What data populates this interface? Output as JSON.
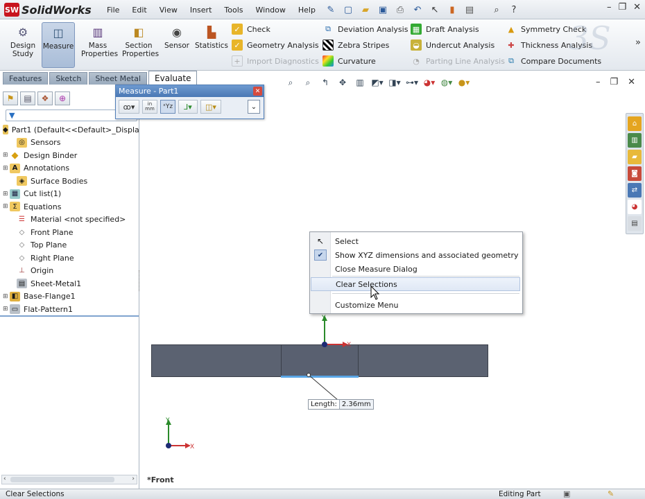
{
  "app": {
    "logo_text": "SolidWorks",
    "logo_mark": "SW"
  },
  "menu": [
    "File",
    "Edit",
    "View",
    "Insert",
    "Tools",
    "Window",
    "Help"
  ],
  "ribbon": {
    "big_buttons": [
      {
        "label": "Design Study"
      },
      {
        "label": "Measure"
      },
      {
        "label": "Mass Properties"
      },
      {
        "label": "Section Properties"
      },
      {
        "label": "Sensor"
      },
      {
        "label": "Statistics"
      }
    ],
    "col1": [
      "Check",
      "Geometry Analysis",
      "Import Diagnostics"
    ],
    "col2": [
      "Deviation Analysis",
      "Zebra Stripes",
      "Curvature"
    ],
    "col3": [
      "Draft Analysis",
      "Undercut Analysis",
      "Parting Line Analysis"
    ],
    "col4": [
      "Symmetry Check",
      "Thickness Analysis",
      "Compare Documents"
    ]
  },
  "tabs": [
    "Features",
    "Sketch",
    "Sheet Metal",
    "Evaluate"
  ],
  "measure_dialog": {
    "title": "Measure - Part1",
    "units_label": "in mm"
  },
  "tree": {
    "root": "Part1  (Default<<Default>_Displa",
    "items": [
      "Sensors",
      "Design Binder",
      "Annotations",
      "Surface Bodies",
      "Cut list(1)",
      "Equations",
      "Material <not specified>",
      "Front Plane",
      "Top Plane",
      "Right Plane",
      "Origin",
      "Sheet-Metal1",
      "Base-Flange1",
      "Flat-Pattern1"
    ]
  },
  "context_menu": {
    "items": [
      "Select",
      "Show XYZ dimensions and associated geometry",
      "Close Measure Dialog",
      "Clear Selections",
      "Customize Menu"
    ]
  },
  "measurement": {
    "label": "Length:",
    "value": "2.36mm"
  },
  "axes": {
    "x": "X",
    "y": "Y"
  },
  "view_label": "*Front",
  "status": {
    "left": "Clear Selections",
    "right": "Editing Part"
  },
  "watermark": "3S"
}
